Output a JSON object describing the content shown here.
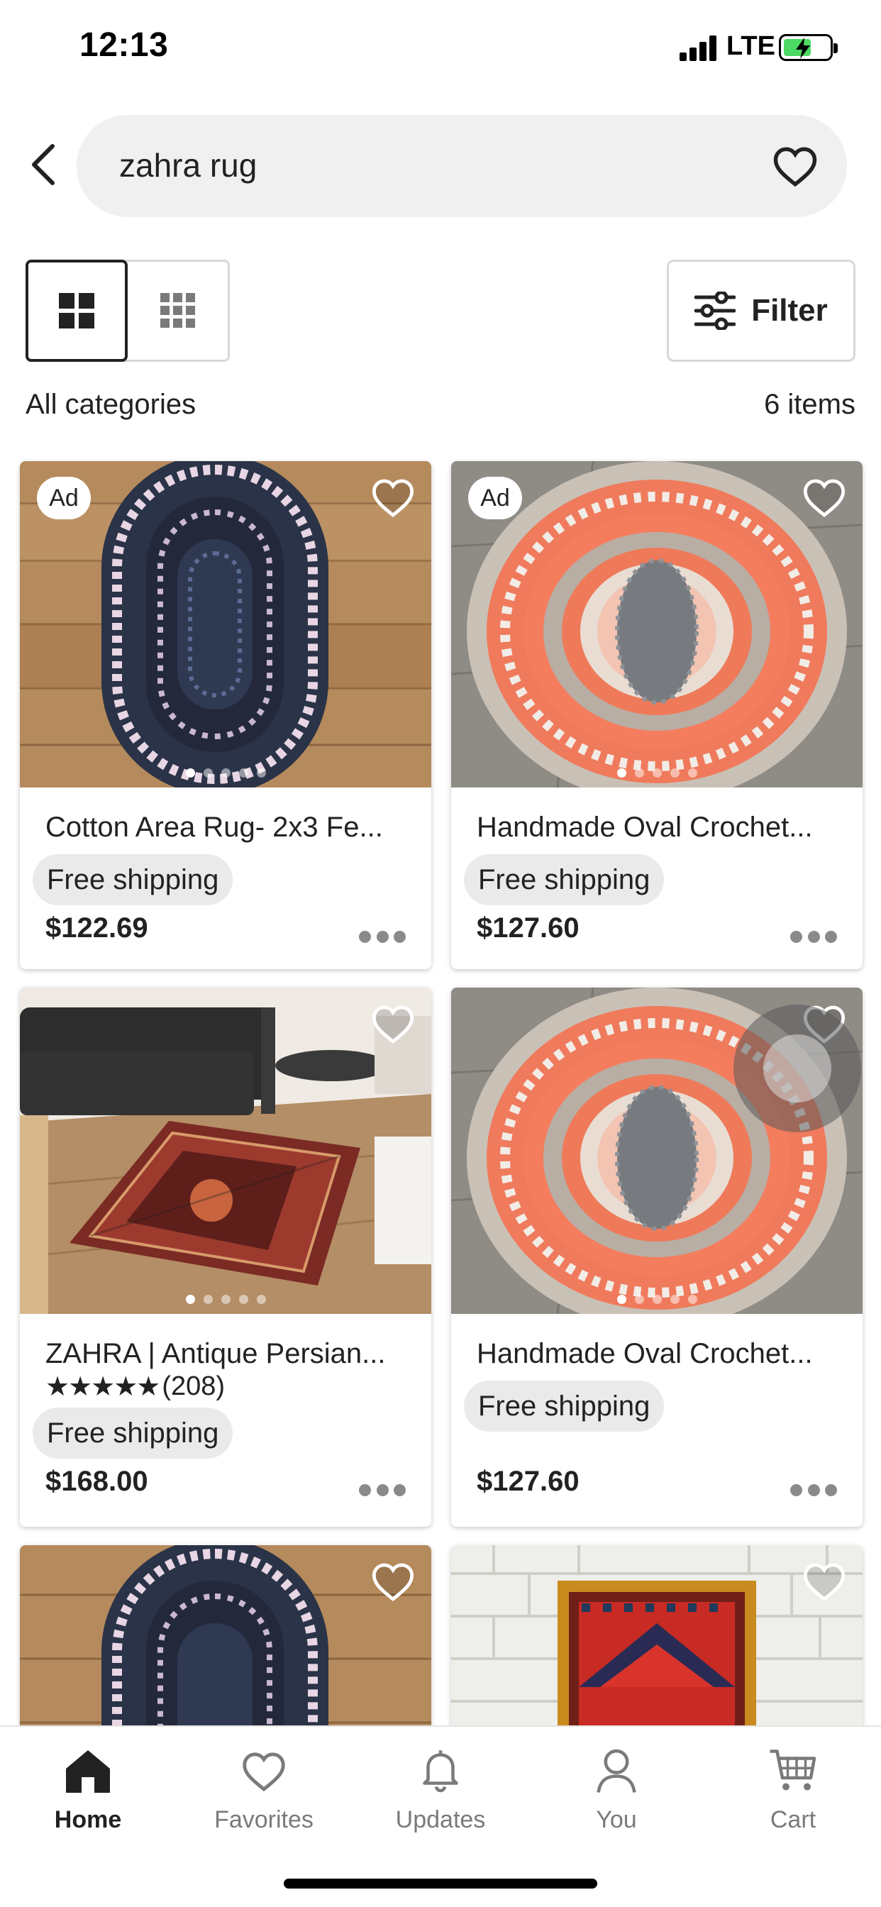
{
  "status_bar": {
    "time": "12:13",
    "network": "LTE"
  },
  "search": {
    "query": "zahra rug"
  },
  "toolbar": {
    "filter_label": "Filter"
  },
  "results": {
    "category": "All categories",
    "count": "6 items"
  },
  "products": [
    {
      "ad": "Ad",
      "title": "Cotton Area Rug- 2x3 Fe...",
      "shipping": "Free shipping",
      "price": "$122.69"
    },
    {
      "ad": "Ad",
      "title": "Handmade Oval Crochet...",
      "shipping": "Free shipping",
      "price": "$127.60"
    },
    {
      "ad": "",
      "title": "ZAHRA | Antique Persian...",
      "stars": "★★★★★",
      "reviews": "(208)",
      "shipping": "Free shipping",
      "price": "$168.00"
    },
    {
      "ad": "",
      "title": "Handmade Oval Crochet...",
      "shipping": "Free shipping",
      "price": "$127.60"
    }
  ],
  "bottom_nav": [
    {
      "label": "Home",
      "icon": "home-icon",
      "active": true
    },
    {
      "label": "Favorites",
      "icon": "heart-icon"
    },
    {
      "label": "Updates",
      "icon": "bell-icon"
    },
    {
      "label": "You",
      "icon": "person-icon"
    },
    {
      "label": "Cart",
      "icon": "cart-icon"
    }
  ],
  "colors": {
    "accent_text": "#222222",
    "pill_bg": "#eaeaea",
    "search_bg": "#f0f0f0",
    "battery": "#4cd964"
  }
}
